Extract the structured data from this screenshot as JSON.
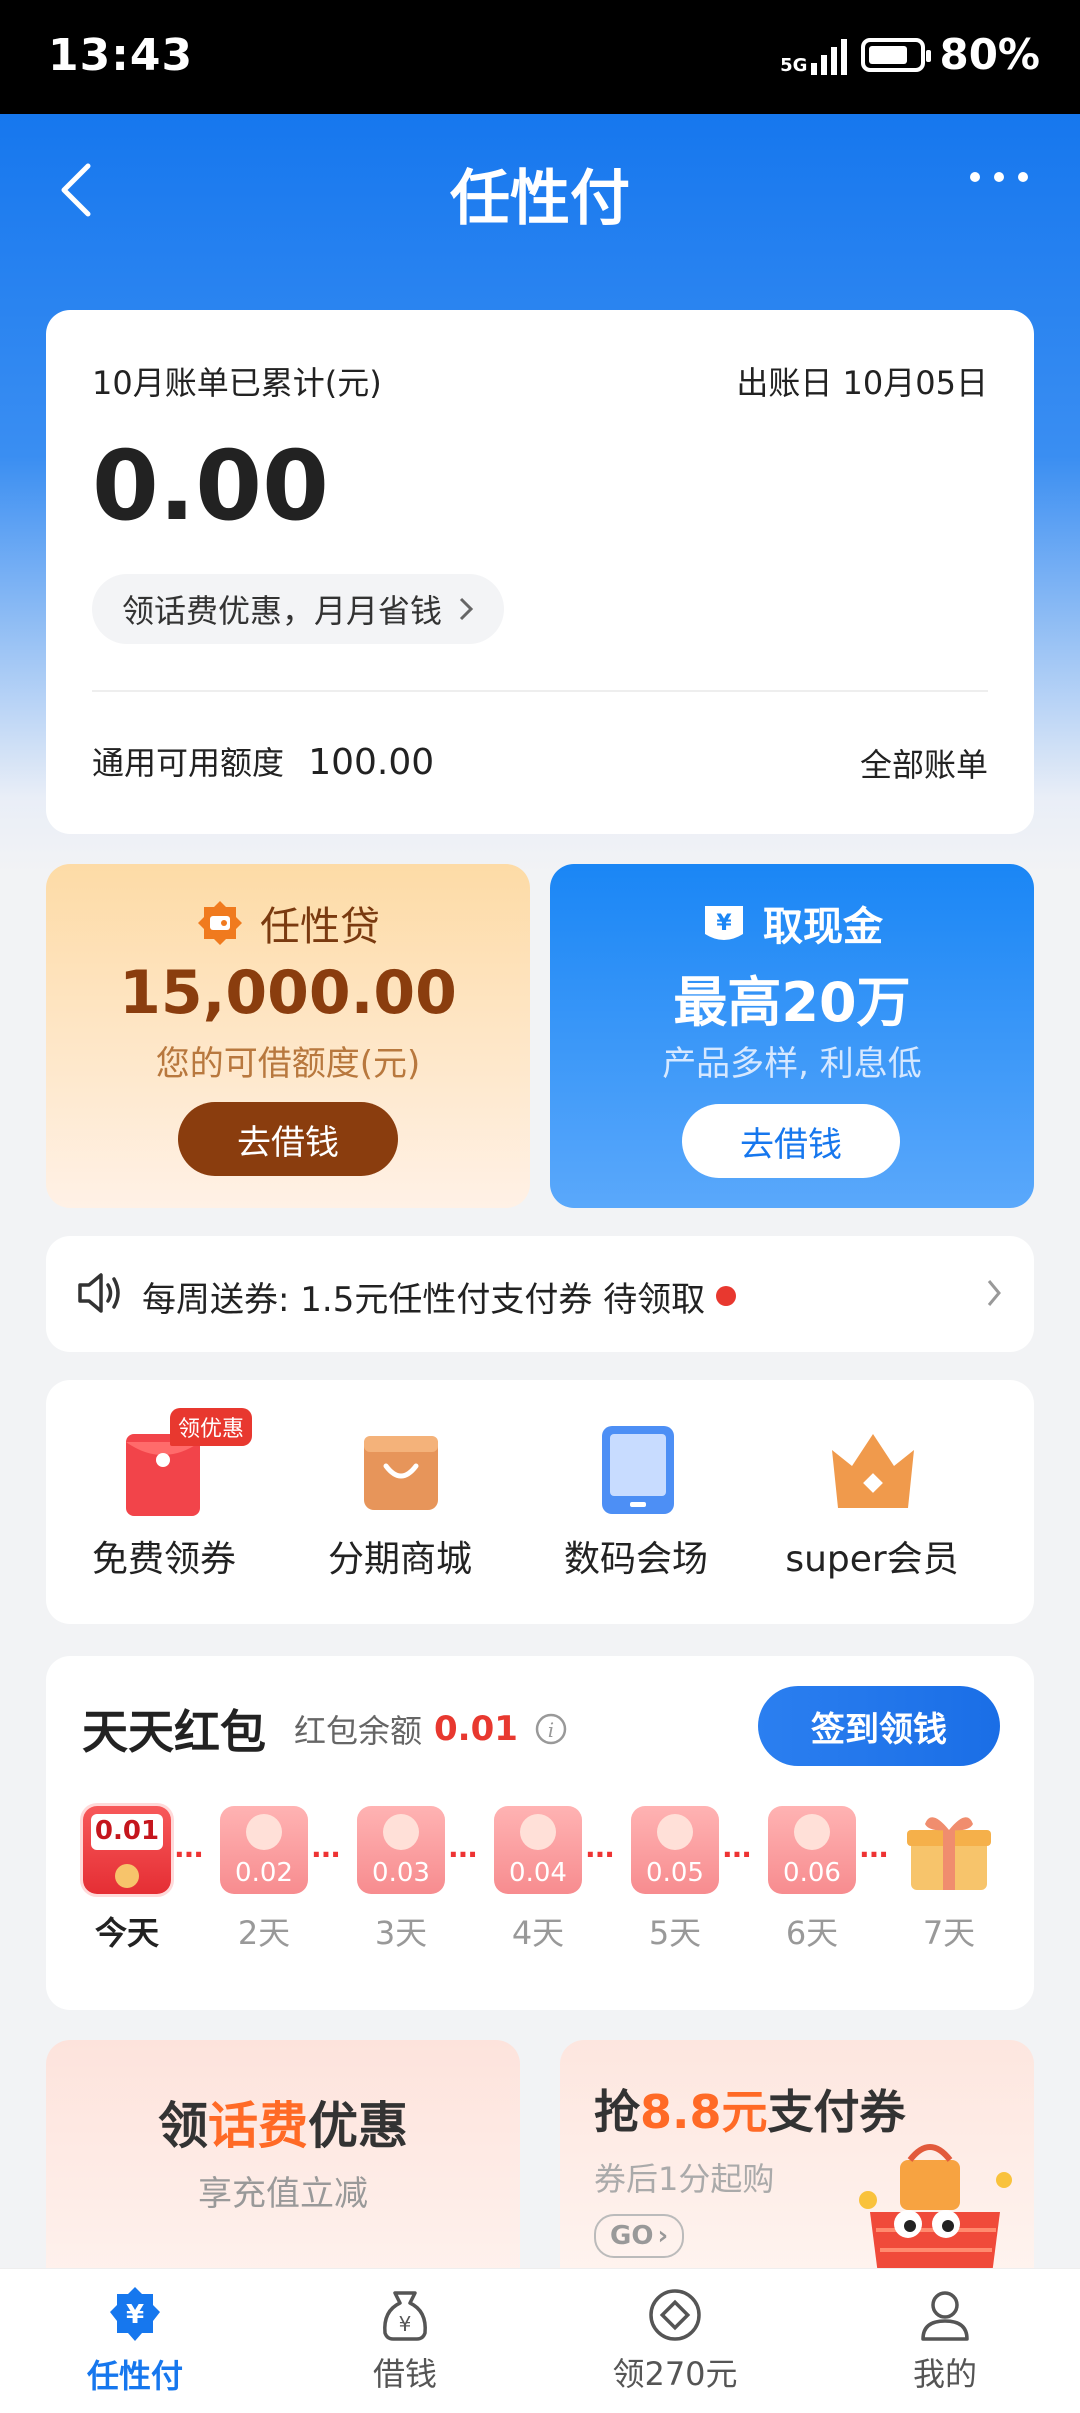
{
  "status": {
    "time": "13:43",
    "network": "5G",
    "battery": "80%",
    "battery_level": 0.8
  },
  "nav": {
    "title": "任性付"
  },
  "bill": {
    "label": "10月账单已累计(元)",
    "due": "出账日 10月05日",
    "amount": "0.00",
    "promo": "领话费优惠，月月省钱",
    "limit_label": "通用可用额度",
    "limit_value": "100.00",
    "all_bills": "全部账单"
  },
  "loan": {
    "title": "任性贷",
    "amount": "15,000.00",
    "sub": "您的可借额度(元)",
    "button": "去借钱"
  },
  "cash": {
    "title": "取现金",
    "amount": "最高20万",
    "sub": "产品多样, 利息低",
    "button": "去借钱"
  },
  "notice": {
    "text": "每周送券: 1.5元任性付支付券 待领取"
  },
  "menu": [
    {
      "label": "免费领券",
      "badge": "领优惠",
      "icon": "red-envelope-icon"
    },
    {
      "label": "分期商城",
      "icon": "shopping-bag-icon"
    },
    {
      "label": "数码会场",
      "icon": "tablet-icon"
    },
    {
      "label": "super会员",
      "icon": "crown-icon"
    }
  ],
  "redpack": {
    "title": "天天红包",
    "balance_label": "红包余额",
    "balance": "0.01",
    "button": "签到领钱",
    "days": [
      {
        "amount": "0.01",
        "label": "今天"
      },
      {
        "amount": "0.02",
        "label": "2天"
      },
      {
        "amount": "0.03",
        "label": "3天"
      },
      {
        "amount": "0.04",
        "label": "4天"
      },
      {
        "amount": "0.05",
        "label": "5天"
      },
      {
        "amount": "0.06",
        "label": "6天"
      },
      {
        "amount": "",
        "label": "7天"
      }
    ]
  },
  "promo1": {
    "title_a": "领",
    "title_b": "话费",
    "title_c": "优惠",
    "sub": "享充值立减"
  },
  "promo2": {
    "title_a": "抢",
    "title_b": "8.8元",
    "title_c": "支付券",
    "sub": "券后1分起购",
    "go": "GO"
  },
  "tabs": [
    {
      "label": "任性付",
      "icon": "yuan-shield-icon",
      "active": true
    },
    {
      "label": "借钱",
      "icon": "money-bag-icon"
    },
    {
      "label": "领270元",
      "icon": "coin-icon"
    },
    {
      "label": "我的",
      "icon": "user-icon"
    }
  ],
  "colors": {
    "brand": "#1677ee",
    "active_tab": "#1677ee",
    "red": "#e8382f",
    "loan_brown": "#8a3d0e"
  }
}
